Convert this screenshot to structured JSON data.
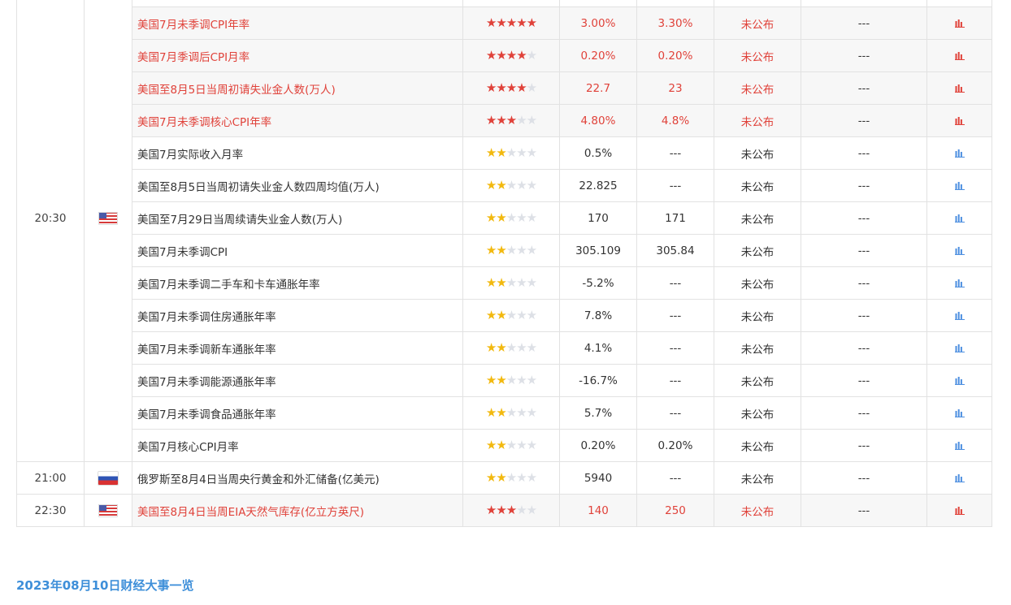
{
  "colors": {
    "high_importance": "#e0423a",
    "normal_text": "#333333",
    "star_yellow": "#f2b90f",
    "star_red": "#e0423a",
    "link_blue": "#3e8fd9"
  },
  "times": {
    "t2030": "20:30",
    "t2100": "21:00",
    "t2230": "22:30"
  },
  "rows": [
    {
      "event": "",
      "stars": 0,
      "previous": "",
      "forecast": "",
      "status": "",
      "actual": "",
      "high": false,
      "filler": true
    },
    {
      "event": "美国7月未季调CPI年率",
      "stars": 5,
      "previous": "3.00%",
      "forecast": "3.30%",
      "status": "未公布",
      "actual": "---",
      "high": true
    },
    {
      "event": "美国7月季调后CPI月率",
      "stars": 4,
      "previous": "0.20%",
      "forecast": "0.20%",
      "status": "未公布",
      "actual": "---",
      "high": true
    },
    {
      "event": "美国至8月5日当周初请失业金人数(万人)",
      "stars": 4,
      "previous": "22.7",
      "forecast": "23",
      "status": "未公布",
      "actual": "---",
      "high": true
    },
    {
      "event": "美国7月未季调核心CPI年率",
      "stars": 3,
      "previous": "4.80%",
      "forecast": "4.8%",
      "status": "未公布",
      "actual": "---",
      "high": true
    },
    {
      "event": "美国7月实际收入月率",
      "stars": 2,
      "previous": "0.5%",
      "forecast": "---",
      "status": "未公布",
      "actual": "---",
      "high": false
    },
    {
      "event": "美国至8月5日当周初请失业金人数四周均值(万人)",
      "stars": 2,
      "previous": "22.825",
      "forecast": "---",
      "status": "未公布",
      "actual": "---",
      "high": false
    },
    {
      "event": "美国至7月29日当周续请失业金人数(万人)",
      "stars": 2,
      "previous": "170",
      "forecast": "171",
      "status": "未公布",
      "actual": "---",
      "high": false
    },
    {
      "event": "美国7月未季调CPI",
      "stars": 2,
      "previous": "305.109",
      "forecast": "305.84",
      "status": "未公布",
      "actual": "---",
      "high": false
    },
    {
      "event": "美国7月未季调二手车和卡车通胀年率",
      "stars": 2,
      "previous": "-5.2%",
      "forecast": "---",
      "status": "未公布",
      "actual": "---",
      "high": false
    },
    {
      "event": "美国7月未季调住房通胀年率",
      "stars": 2,
      "previous": "7.8%",
      "forecast": "---",
      "status": "未公布",
      "actual": "---",
      "high": false
    },
    {
      "event": "美国7月未季调新车通胀年率",
      "stars": 2,
      "previous": "4.1%",
      "forecast": "---",
      "status": "未公布",
      "actual": "---",
      "high": false
    },
    {
      "event": "美国7月未季调能源通胀年率",
      "stars": 2,
      "previous": "-16.7%",
      "forecast": "---",
      "status": "未公布",
      "actual": "---",
      "high": false
    },
    {
      "event": "美国7月未季调食品通胀年率",
      "stars": 2,
      "previous": "5.7%",
      "forecast": "---",
      "status": "未公布",
      "actual": "---",
      "high": false
    },
    {
      "event": "美国7月核心CPI月率",
      "stars": 2,
      "previous": "0.20%",
      "forecast": "0.20%",
      "status": "未公布",
      "actual": "---",
      "high": false
    },
    {
      "event": "俄罗斯至8月4日当周央行黄金和外汇储备(亿美元)",
      "stars": 2,
      "previous": "5940",
      "forecast": "---",
      "status": "未公布",
      "actual": "---",
      "high": false
    },
    {
      "event": "美国至8月4日当周EIA天然气库存(亿立方英尺)",
      "stars": 3,
      "previous": "140",
      "forecast": "250",
      "status": "未公布",
      "actual": "---",
      "high": true
    }
  ],
  "icons": {
    "us_flag": "us-flag-icon",
    "ru_flag": "russia-flag-icon",
    "chart": "bar-chart-icon"
  },
  "footer": {
    "headline": "2023年08月10日财经大事一览"
  }
}
